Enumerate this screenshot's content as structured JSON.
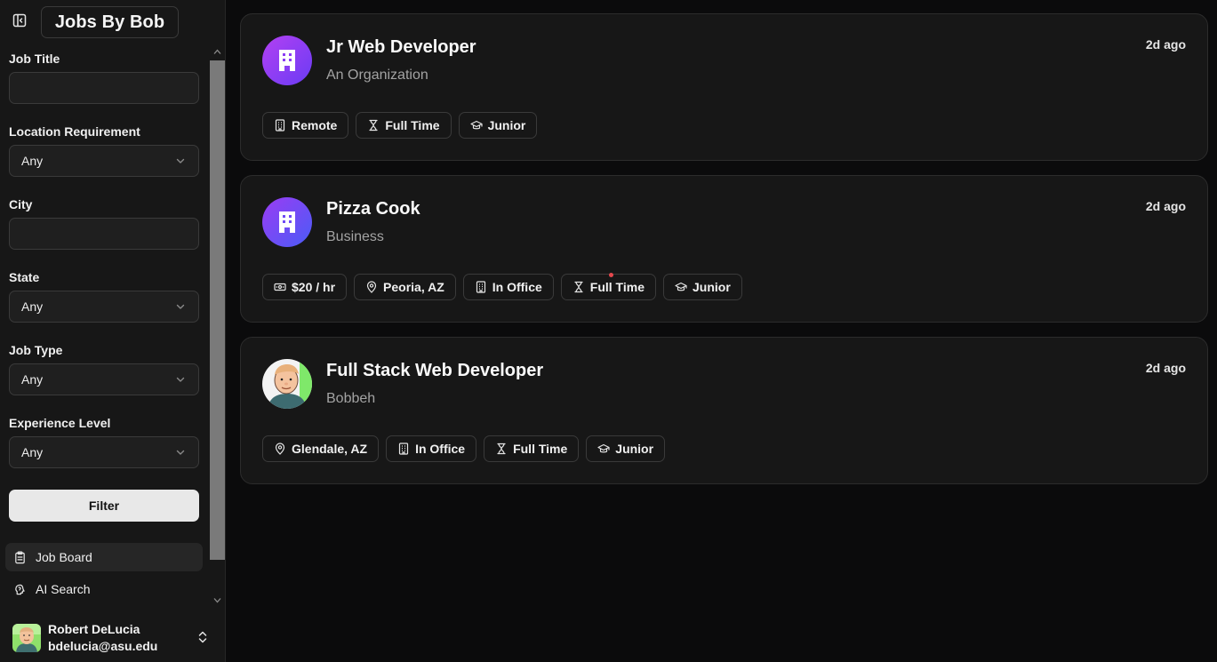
{
  "app": {
    "brand": "Jobs By Bob"
  },
  "filters": {
    "job_title": {
      "label": "Job Title",
      "value": ""
    },
    "location_requirement": {
      "label": "Location Requirement",
      "value": "Any"
    },
    "city": {
      "label": "City",
      "value": ""
    },
    "state": {
      "label": "State",
      "value": "Any"
    },
    "job_type": {
      "label": "Job Type",
      "value": "Any"
    },
    "experience_level": {
      "label": "Experience Level",
      "value": "Any"
    },
    "filter_button": "Filter"
  },
  "nav": {
    "job_board": "Job Board",
    "ai_search": "AI Search"
  },
  "user": {
    "name": "Robert DeLucia",
    "email": "bdelucia@asu.edu"
  },
  "jobs": [
    {
      "title": "Jr Web Developer",
      "company": "An Organization",
      "posted": "2d ago",
      "tags": [
        "Remote",
        "Full Time",
        "Junior"
      ]
    },
    {
      "title": "Pizza Cook",
      "company": "Business",
      "posted": "2d ago",
      "tags": [
        "$20 / hr",
        "Peoria, AZ",
        "In Office",
        "Full Time",
        "Junior"
      ]
    },
    {
      "title": "Full Stack Web Developer",
      "company": "Bobbeh",
      "posted": "2d ago",
      "tags": [
        "Glendale, AZ",
        "In Office",
        "Full Time",
        "Junior"
      ]
    }
  ],
  "colors": {
    "background": "#0b0b0c",
    "sidebar": "#171717",
    "card": "#171717",
    "logo_gradient_start": "#b340f2",
    "logo_gradient_end": "#6a3cf5",
    "notification_dot": "#e5484d"
  },
  "icons": {
    "sidebar_toggle": "panel-left-icon",
    "remote": "building-icon",
    "in_office": "building-icon",
    "full_time": "hourglass-icon",
    "junior": "graduation-cap-icon",
    "salary": "banknote-icon",
    "location": "map-pin-icon",
    "job_board": "clipboard-icon",
    "ai_search": "brain-icon"
  }
}
